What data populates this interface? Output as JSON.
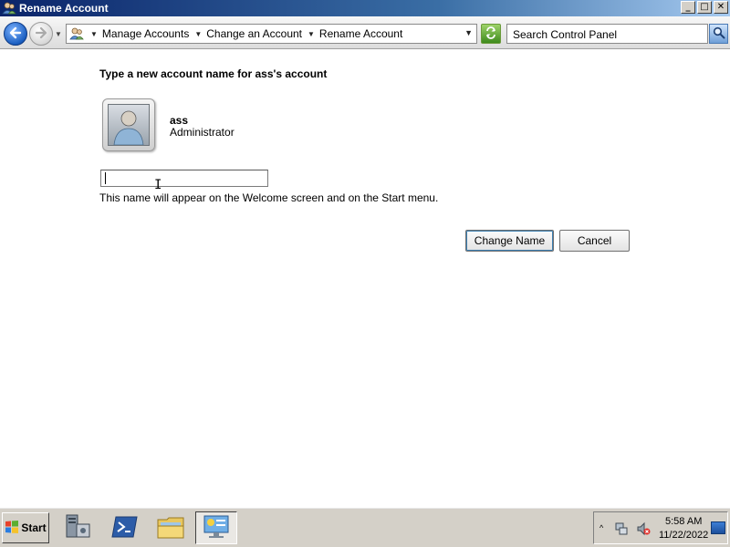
{
  "window": {
    "title": "Rename Account",
    "controls": {
      "minimize": "_",
      "maximize": "□",
      "close": "✕"
    }
  },
  "addressbar": {
    "breadcrumbs": [
      "Manage Accounts",
      "Change an Account",
      "Rename Account"
    ],
    "search": {
      "placeholder": "Search Control Panel"
    }
  },
  "content": {
    "heading": "Type a new account name for ass's account",
    "account": {
      "name": "ass",
      "role": "Administrator"
    },
    "name_field": {
      "value": ""
    },
    "hint": "This name will appear on the Welcome screen and on the Start menu.",
    "buttons": {
      "change_name": "Change Name",
      "cancel": "Cancel"
    }
  },
  "taskbar": {
    "start_label": "Start",
    "clock": {
      "time": "5:58 AM",
      "date": "11/22/2022"
    }
  },
  "colors": {
    "title_bar_start": "#0a246a",
    "title_bar_end": "#a6caf0",
    "taskbar": "#d4d0c8",
    "back_button": "#1b5fc1"
  }
}
